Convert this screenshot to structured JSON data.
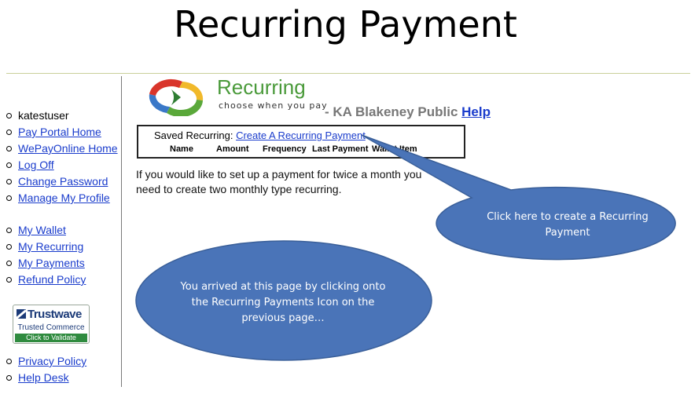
{
  "slide": {
    "title": "Recurring Payment"
  },
  "sidebar": {
    "username": "katestuser",
    "group1": [
      {
        "label": "Pay Portal Home",
        "name": "nav-pay-portal-home"
      },
      {
        "label": "WePayOnline Home",
        "name": "nav-wepayonline-home"
      },
      {
        "label": "Log Off",
        "name": "nav-log-off"
      },
      {
        "label": "Change Password",
        "name": "nav-change-password"
      },
      {
        "label": "Manage My Profile",
        "name": "nav-manage-my-profile"
      }
    ],
    "group2": [
      {
        "label": "My Wallet",
        "name": "nav-my-wallet"
      },
      {
        "label": "My Recurring",
        "name": "nav-my-recurring"
      },
      {
        "label": "My Payments",
        "name": "nav-my-payments"
      },
      {
        "label": "Refund Policy",
        "name": "nav-refund-policy"
      }
    ],
    "group3": [
      {
        "label": "Privacy Policy",
        "name": "nav-privacy-policy"
      },
      {
        "label": "Help Desk",
        "name": "nav-help-desk"
      }
    ],
    "trustwave": {
      "name": "Trustwave",
      "subtitle": "Trusted Commerce",
      "button": "Click to Validate"
    }
  },
  "header": {
    "logo_word": "Recurring",
    "logo_tagline": "choose when you pay",
    "org": "- KA Blakeney Public",
    "help_link": "Help"
  },
  "recurring_box": {
    "saved_label": "Saved Recurring:",
    "create_link": "Create A Recurring Payment",
    "columns": [
      "Name",
      "Amount",
      "Frequency",
      "Last Payment",
      "Wallet Item"
    ]
  },
  "info": {
    "line1": "If you would like to set up a payment for twice a month you",
    "line2": "need to create two monthly type recurring."
  },
  "callouts": {
    "right": "Click here to create a Recurring Payment",
    "left": "You arrived at this page by clicking onto the Recurring Payments Icon on the previous page…",
    "fill": "#4a74b8",
    "stroke": "#3a5f99"
  },
  "colors": {
    "link": "#1a3ccc",
    "logo_green": "#4a9a3a",
    "badge_green": "#2f8b3f",
    "badge_blue": "#1b3a78"
  }
}
